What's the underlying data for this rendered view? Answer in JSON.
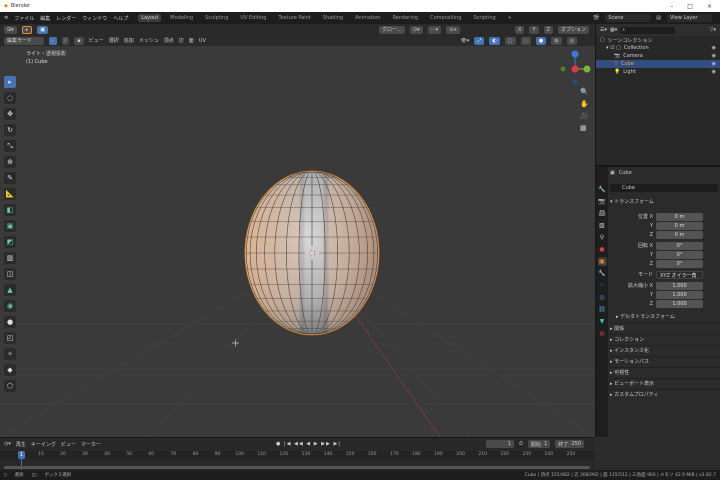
{
  "window": {
    "title": "Blender",
    "minimize": "–",
    "maximize": "□",
    "close": "×"
  },
  "menu": [
    "ファイル",
    "編集",
    "レンダー",
    "ウィンドウ",
    "ヘルプ"
  ],
  "workspaces": [
    "Layout",
    "Modeling",
    "Sculpting",
    "UV Editing",
    "Texture Paint",
    "Shading",
    "Animation",
    "Rendering",
    "Compositing",
    "Scripting",
    "+"
  ],
  "scene": "Scene",
  "view_layer": "View Layer",
  "viewport": {
    "mode": "編集モード",
    "menus": [
      "ビュー",
      "選択",
      "追加",
      "メッシュ",
      "頂点",
      "辺",
      "面",
      "UV"
    ],
    "orientation": "グロー…",
    "options": "オプション",
    "xyz": [
      "X",
      "Y",
      "Z"
    ],
    "overlay_title": "ライト・透視投影",
    "overlay_object": "(1) Cube"
  },
  "outliner": {
    "root": "シーンコレクション",
    "items": [
      {
        "name": "Collection"
      },
      {
        "name": "Camera"
      },
      {
        "name": "Cube"
      },
      {
        "name": "Light"
      }
    ]
  },
  "properties": {
    "object": "Cube",
    "object_field": "Cube",
    "transform": "トランスフォーム",
    "location": {
      "label": "位置 X",
      "x": "0 m",
      "y": "0 m",
      "z": "0 m"
    },
    "rotation": {
      "label": "回転 X",
      "x": "0°",
      "y": "0°",
      "z": "0°"
    },
    "mode_label": "モード",
    "mode": "XYZ オイラー角",
    "scale": {
      "label": "拡大縮小 X",
      "x": "1.000",
      "y": "1.000",
      "z": "1.000"
    },
    "axis_y": "Y",
    "axis_z": "Z",
    "delta": "デルタトランスフォーム",
    "sections": [
      "関係",
      "コレクション",
      "インスタンス化",
      "モーションパス",
      "可視性",
      "ビューポート表示",
      "カスタムプロパティ"
    ]
  },
  "timeline": {
    "menus": [
      "再生",
      "キーイング",
      "ビュー",
      "マーカー"
    ],
    "current_frame": "1",
    "start_label": "開始",
    "start": "1",
    "end_label": "終了",
    "end": "250",
    "ticks": [
      "1",
      "10",
      "20",
      "30",
      "40",
      "50",
      "60",
      "70",
      "80",
      "90",
      "100",
      "110",
      "120",
      "130",
      "140",
      "150",
      "160",
      "170",
      "180",
      "190",
      "200",
      "210",
      "220",
      "230",
      "240",
      "250"
    ]
  },
  "status": {
    "select": "選択",
    "box_select": "ボックス選択",
    "stats": "Cube | 頂点 155/482 | 辺 268/992 | 面 115/512 | 三角面 960 | メモリ 42.9 MiB | v2.82.7"
  }
}
